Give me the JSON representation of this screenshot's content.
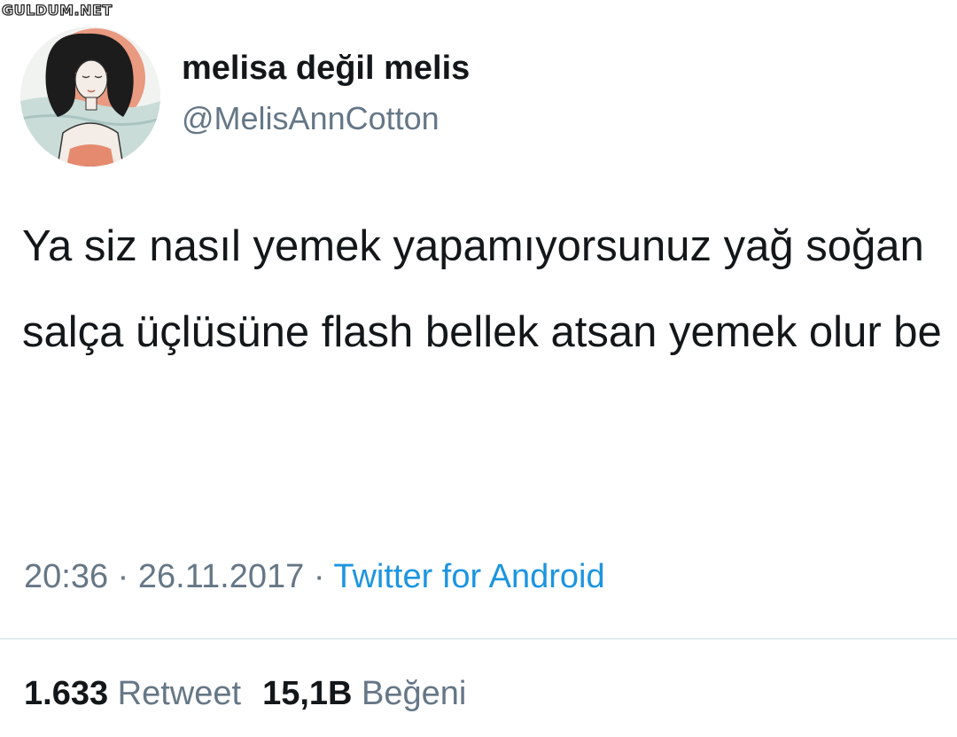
{
  "watermark": "GULDUM.NET",
  "tweet": {
    "display_name": "melisa değil melis",
    "handle": "@MelisAnnCotton",
    "text": "Ya siz nasıl yemek yapamıyorsunuz yağ soğan salça üçlüsüne flash bellek atsan yemek olur be",
    "time": "20:36",
    "separator": "·",
    "date": "26.11.2017",
    "source": "Twitter for Android"
  },
  "stats": {
    "retweet_count": "1.633",
    "retweet_label": "Retweet",
    "like_count": "15,1B",
    "like_label": "Beğeni"
  },
  "avatar": {
    "icon": "illustrated-woman-avatar",
    "colors": {
      "sky": "#e99a80",
      "water": "#c9dcd8",
      "hair": "#1c1c1c",
      "skin": "#f4ece6",
      "swimsuit": "#e58a6e"
    }
  },
  "colors": {
    "text": "#14171a",
    "secondary": "#657786",
    "link": "#1b95e0",
    "divider": "#e6ecf0"
  }
}
